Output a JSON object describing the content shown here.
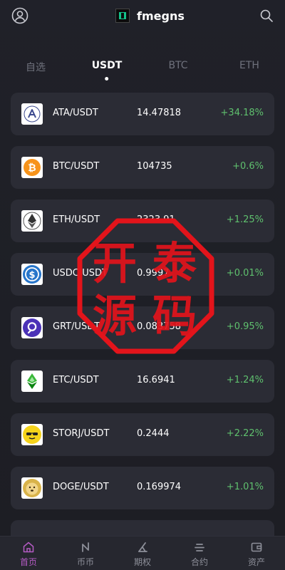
{
  "header": {
    "title": "fmegns"
  },
  "tabs": [
    {
      "label": "自选"
    },
    {
      "label": "USDT"
    },
    {
      "label": "BTC"
    },
    {
      "label": "ETH"
    }
  ],
  "markets": [
    {
      "pair": "ATA/USDT",
      "price": "14.47818",
      "change": "+34.18%"
    },
    {
      "pair": "BTC/USDT",
      "price": "104735",
      "change": "+0.6%"
    },
    {
      "pair": "ETH/USDT",
      "price": "2323.91",
      "change": "+1.25%"
    },
    {
      "pair": "USDC/USDT",
      "price": "0.9997",
      "change": "+0.01%"
    },
    {
      "pair": "GRT/USDT",
      "price": "0.083758",
      "change": "+0.95%"
    },
    {
      "pair": "ETC/USDT",
      "price": "16.6941",
      "change": "+1.24%"
    },
    {
      "pair": "STORJ/USDT",
      "price": "0.2444",
      "change": "+2.22%"
    },
    {
      "pair": "DOGE/USDT",
      "price": "0.169974",
      "change": "+1.01%"
    }
  ],
  "watermark": {
    "chars": [
      "开",
      "泰",
      "源",
      "码"
    ],
    "color": "#e3141b"
  },
  "bottom_nav": [
    {
      "label": "首页"
    },
    {
      "label": "币币"
    },
    {
      "label": "期权"
    },
    {
      "label": "合约"
    },
    {
      "label": "资产"
    }
  ],
  "colors": {
    "accent": "#b45bc4",
    "positive": "#5fc06e",
    "card": "#2b2c35"
  }
}
